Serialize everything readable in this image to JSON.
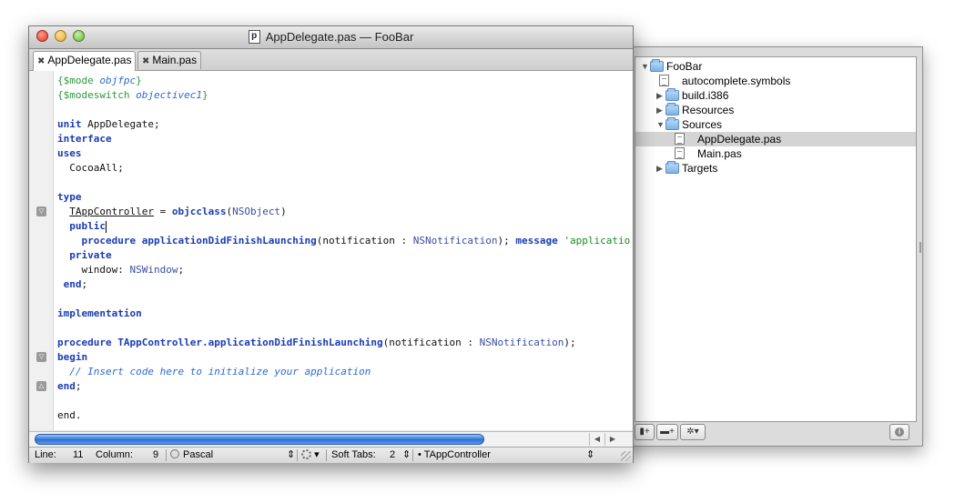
{
  "window": {
    "title": "AppDelegate.pas — FooBar",
    "doc_icon_letter": "p",
    "tabs": [
      {
        "label": "AppDelegate.pas",
        "close": "✖",
        "active": true
      },
      {
        "label": "Main.pas",
        "close": "✖",
        "active": false
      }
    ]
  },
  "code": {
    "cursor_line": 11,
    "lines": [
      "{$mode objfpc}",
      "{$modeswitch objectivec1}",
      "",
      "unit AppDelegate;",
      "interface",
      "uses",
      "  CocoaAll;",
      "",
      "type",
      "  TAppController = objcclass(NSObject)",
      "  public",
      "    procedure applicationDidFinishLaunching(notification : NSNotification); message 'applicatio",
      "  private",
      "    window: NSWindow;",
      " end;",
      "",
      "implementation",
      "",
      "procedure TAppController.applicationDidFinishLaunching(notification : NSNotification);",
      "begin",
      "  // Insert code here to initialize your application",
      "end;",
      "",
      "end."
    ],
    "fold_markers": [
      {
        "line": 10,
        "symbol": "▽"
      },
      {
        "line": 20,
        "symbol": "▽"
      },
      {
        "line": 22,
        "symbol": "△"
      }
    ]
  },
  "statusbar": {
    "line_label": "Line:",
    "line_value": "11",
    "column_label": "Column:",
    "column_value": "9",
    "language": "Pascal",
    "soft_tabs_label": "Soft Tabs:",
    "soft_tabs_value": "2",
    "symbol": "• TAppController",
    "updown": "⇕",
    "dropdown": "▾"
  },
  "scroll_arrows": {
    "left": "◀",
    "right": "▶"
  },
  "project": {
    "tree": [
      {
        "label": "FooBar",
        "type": "folder",
        "level": 0,
        "expanded": true,
        "disclosure": "▼"
      },
      {
        "label": "autocomplete.symbols",
        "type": "file",
        "level": 1
      },
      {
        "label": "build.i386",
        "type": "folder",
        "level": 1,
        "expanded": false,
        "disclosure": "▶"
      },
      {
        "label": "Resources",
        "type": "folder",
        "level": 1,
        "expanded": false,
        "disclosure": "▶"
      },
      {
        "label": "Sources",
        "type": "folder",
        "level": 1,
        "expanded": true,
        "disclosure": "▼"
      },
      {
        "label": "AppDelegate.pas",
        "type": "file",
        "level": 2,
        "selected": true
      },
      {
        "label": "Main.pas",
        "type": "file",
        "level": 2
      },
      {
        "label": "Targets",
        "type": "folder",
        "level": 1,
        "expanded": false,
        "disclosure": "▶"
      }
    ],
    "toolbar": {
      "new_file": "+",
      "new_folder": "+",
      "action_menu": "▾",
      "info": "i"
    }
  },
  "colors": {
    "keyword": "#1a3cb4",
    "comment": "#2a6ad2",
    "directive": "#2a9a3a",
    "string": "#1f8a1f",
    "selection": "#d4d4d4",
    "scroll_thumb": "#2c6fd6"
  }
}
